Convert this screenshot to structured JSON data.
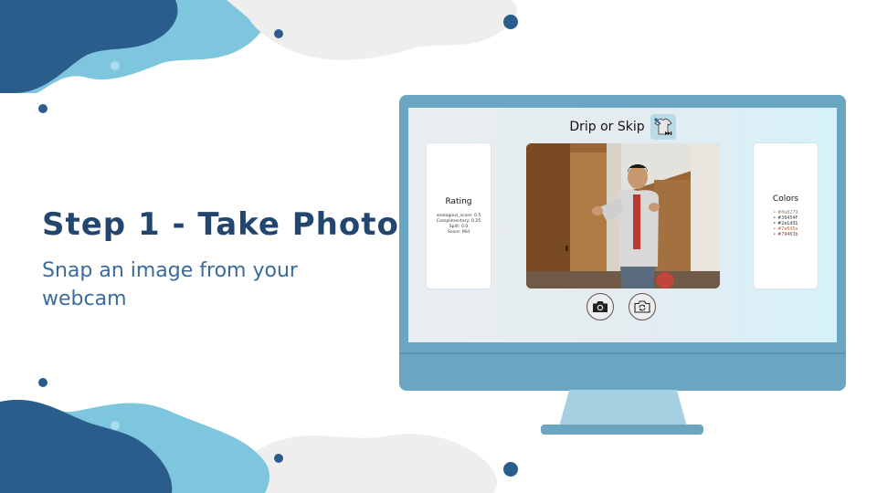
{
  "slide": {
    "headline": "Step 1 - Take Photo",
    "subtitle": "Snap an image from your webcam"
  },
  "app": {
    "title": "Drip or Skip",
    "logo_icon": "tshirt-skip-icon"
  },
  "rating": {
    "heading": "Rating",
    "lines": [
      "analogous_score: 0.5",
      "Complimentary: 0.25",
      "Split: 0.0",
      "Score: Mid"
    ]
  },
  "colors": {
    "heading": "Colors",
    "items": [
      {
        "hex": "#8e8279",
        "text_color": "#8e8279"
      },
      {
        "hex": "#36454F",
        "text_color": "#36454F"
      },
      {
        "hex": "#2e1d31",
        "text_color": "#2e1d31"
      },
      {
        "hex": "#7e6d5a",
        "text_color": "#b06a3c"
      },
      {
        "hex": "#79463b",
        "text_color": "#79463b"
      }
    ]
  },
  "controls": {
    "capture_icon": "camera-icon",
    "switch_icon": "switch-camera-icon"
  },
  "theme": {
    "headline_color": "#22466e",
    "subtitle_color": "#3a6b9c",
    "monitor_color": "#6aa6c2",
    "blob_dark": "#2a5d8c",
    "blob_light": "#7ec6dd"
  }
}
